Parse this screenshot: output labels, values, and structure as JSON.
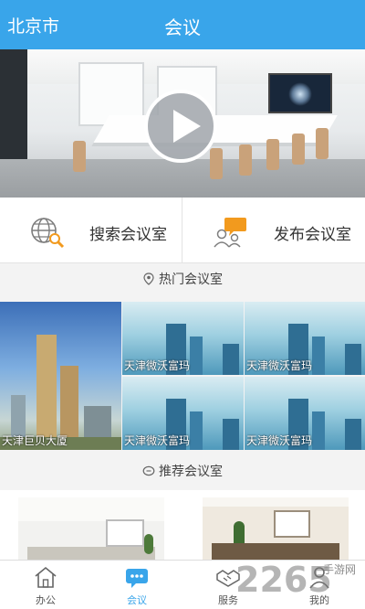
{
  "header": {
    "city": "北京市",
    "title": "会议"
  },
  "actions": [
    {
      "label": "搜索会议室",
      "icon": "globe-search-icon"
    },
    {
      "label": "发布会议室",
      "icon": "people-chat-icon"
    }
  ],
  "hot": {
    "title": "热门会议室",
    "icon": "location-pin-icon",
    "tiles": [
      {
        "caption": "天津巨贝大厦"
      },
      {
        "caption": "天津微沃富玛"
      },
      {
        "caption": "天津微沃富玛"
      },
      {
        "caption": "天津微沃富玛"
      },
      {
        "caption": "天津微沃富玛"
      }
    ]
  },
  "recommended": {
    "title": "推荐会议室",
    "icon": "chat-bubble-icon"
  },
  "tabs": [
    {
      "label": "办公",
      "icon": "home-icon"
    },
    {
      "label": "会议",
      "icon": "chat-dots-icon",
      "active": true
    },
    {
      "label": "服务",
      "icon": "handshake-icon"
    },
    {
      "label": "我的",
      "icon": "person-icon"
    }
  ],
  "watermark": {
    "number": "2265",
    "site": "手游网"
  },
  "colors": {
    "primary": "#39a5ea",
    "background": "#f3f3f3"
  }
}
